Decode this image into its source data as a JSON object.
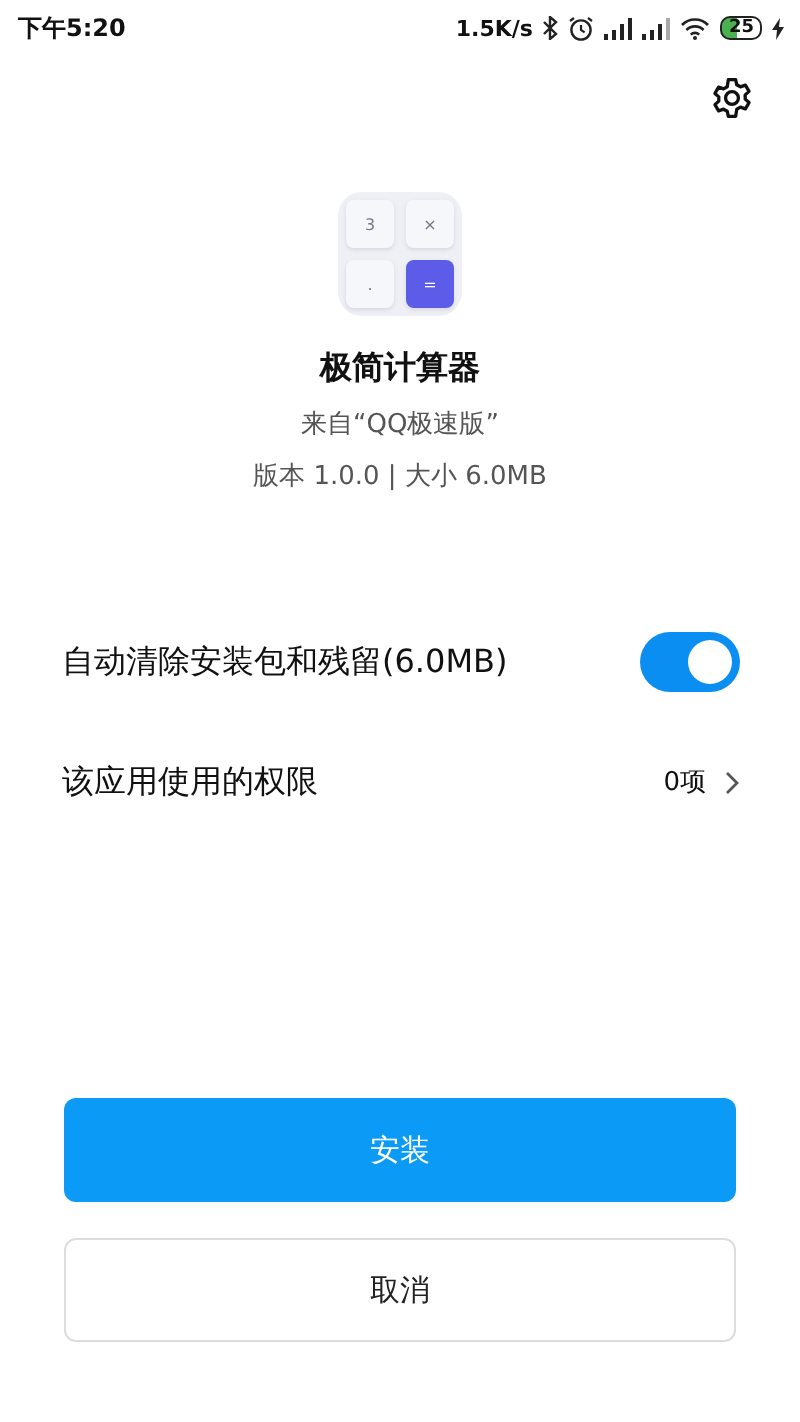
{
  "status_bar": {
    "time": "下午5:20",
    "net_speed": "1.5K/s",
    "battery": "25",
    "charging": true
  },
  "app": {
    "icon_keys": [
      "3",
      "×",
      ".",
      "="
    ],
    "name": "极简计算器",
    "source": "来自“QQ极速版”",
    "version_info": "版本 1.0.0 | 大小 6.0MB"
  },
  "options": [
    {
      "kind": "toggle",
      "label": "自动清除安装包和残留(6.0MB)",
      "on": true
    },
    {
      "kind": "link",
      "label": "该应用使用的权限",
      "value": "0项"
    }
  ],
  "buttons": [
    {
      "kind": "primary",
      "label": "安装"
    },
    {
      "kind": "secondary",
      "label": "取消"
    }
  ]
}
